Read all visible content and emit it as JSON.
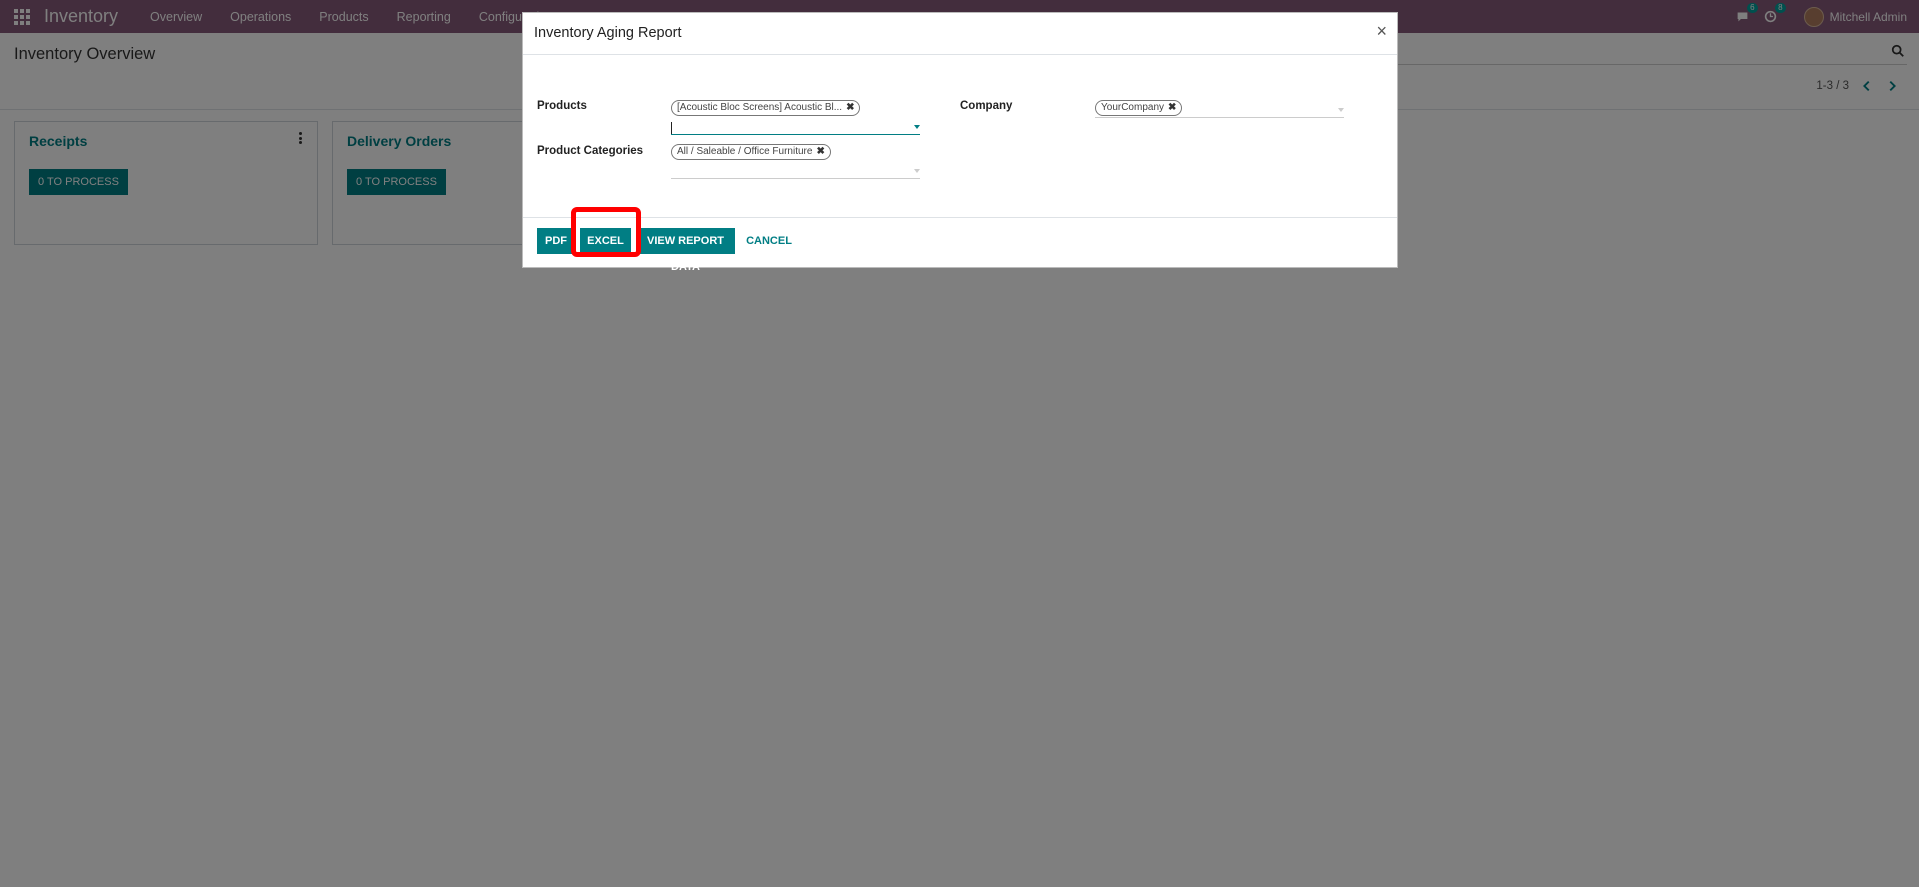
{
  "navbar": {
    "brand": "Inventory",
    "menu": [
      "Overview",
      "Operations",
      "Products",
      "Reporting",
      "Configuration"
    ],
    "messages_count": "6",
    "activities_count": "8",
    "user_name": "Mitchell Admin"
  },
  "control_panel": {
    "title": "Inventory Overview",
    "pager": "1-3 / 3"
  },
  "cards": [
    {
      "title": "Receipts",
      "button": "0 TO PROCESS"
    },
    {
      "title": "Delivery Orders",
      "button": "0 TO PROCESS"
    }
  ],
  "modal": {
    "title": "Inventory Aging Report",
    "close": "×",
    "fields": {
      "products_label": "Products",
      "products_tag": "[Acoustic Bloc Screens] Acoustic Bl...",
      "product_categories_label": "Product Categories",
      "product_categories_tag": "All / Saleable / Office Furniture",
      "company_label": "Company",
      "company_tag": "YourCompany"
    },
    "buttons": {
      "pdf": "PDF",
      "excel": "EXCEL",
      "view_report_data": "VIEW REPORT DATA",
      "cancel": "CANCEL"
    }
  },
  "colors": {
    "navbar": "#875a7b",
    "primary": "#017e84",
    "highlight": "#ff0000"
  }
}
